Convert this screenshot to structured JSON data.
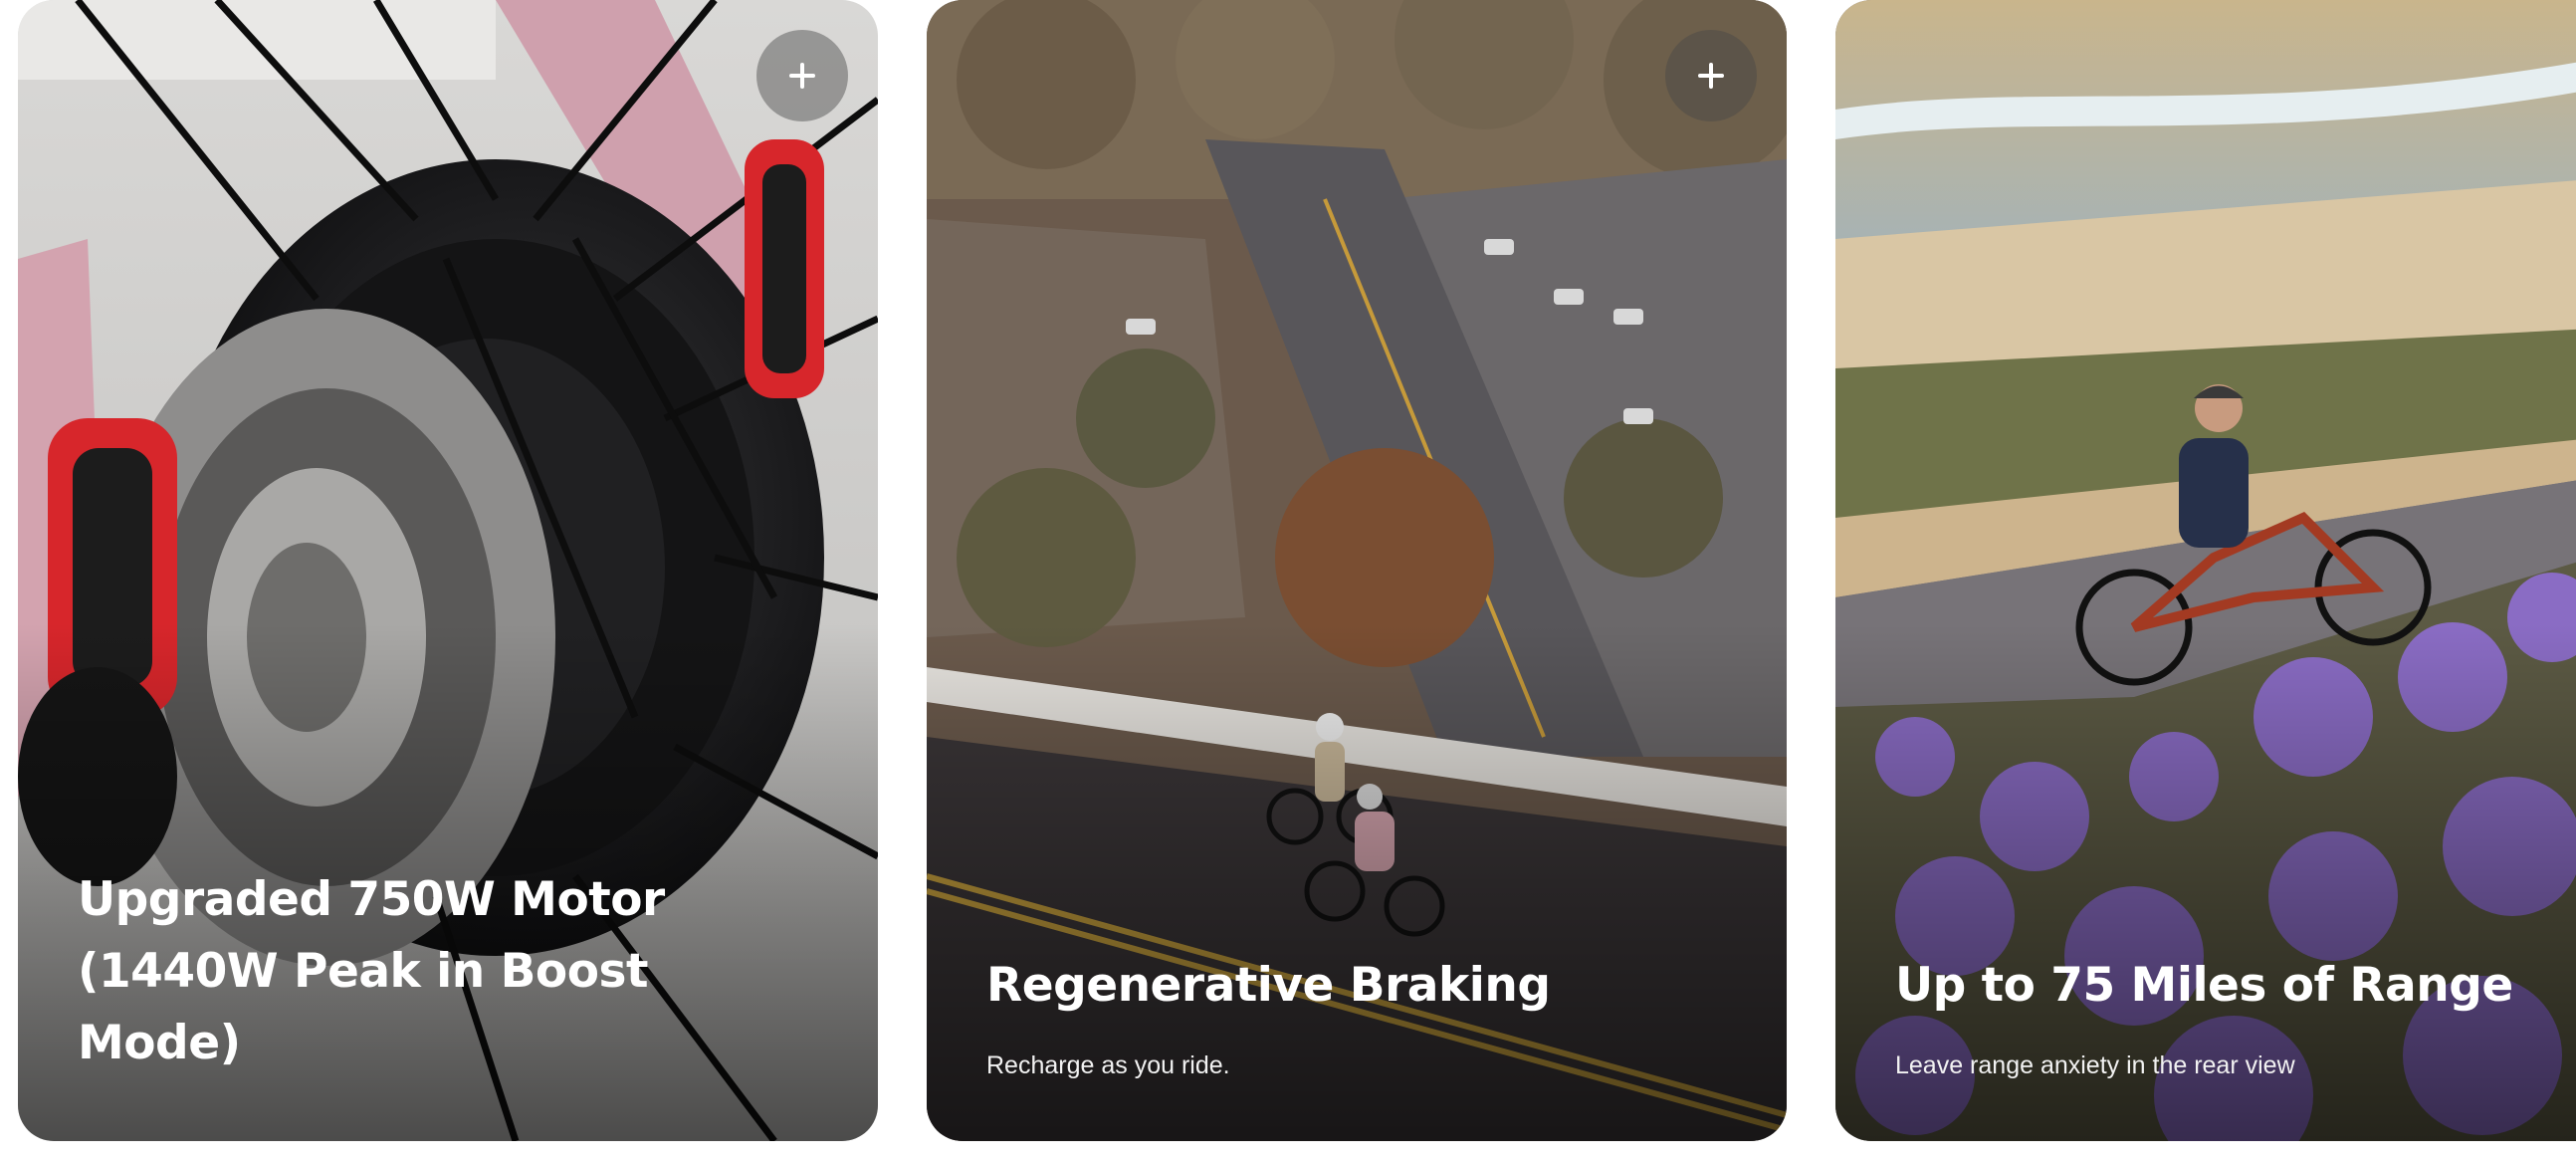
{
  "cards": [
    {
      "title": "Upgraded 750W Motor (1440W Peak in Boost Mode)",
      "subtitle": "",
      "expand_icon": "plus-icon"
    },
    {
      "title": "Regenerative Braking",
      "subtitle": "Recharge as you ride.",
      "expand_icon": "plus-icon"
    },
    {
      "title": "Up to 75 Miles of Range",
      "subtitle": "Leave range anxiety in the rear view",
      "expand_icon": "plus-icon"
    }
  ],
  "colors": {
    "caption_text": "#ffffff",
    "button_overlay": "#464646",
    "taillight_red": "#d7262b",
    "frame_pink": "#d8a7b1",
    "road_asphalt": "#3b3638",
    "lavender_flowers": "#8a6cc4"
  }
}
